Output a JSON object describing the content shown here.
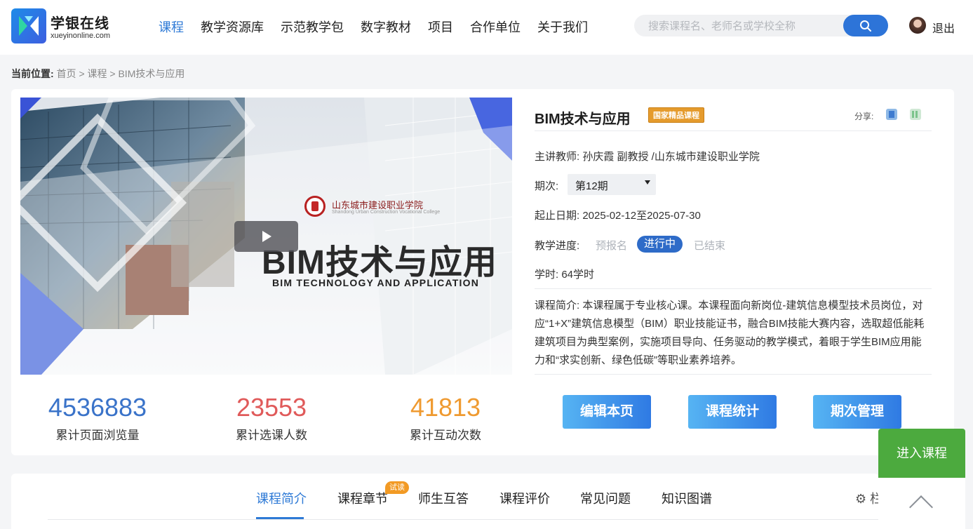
{
  "brand": {
    "name": "学银在线",
    "domain": "xueyinonline.com"
  },
  "nav": [
    "课程",
    "教学资源库",
    "示范教学包",
    "数字教材",
    "项目",
    "合作单位",
    "关于我们"
  ],
  "search": {
    "placeholder": "搜索课程名、老师名或学校全称"
  },
  "user": {
    "logout": "退出"
  },
  "breadcrumb": {
    "lead": "当前位置:",
    "path": "首页 > 课程 > BIM技术与应用"
  },
  "cover": {
    "school_cn": "山东城市建设职业学院",
    "school_en": "Shandong Urban Construction Vocational College",
    "title": "BIM技术与应用",
    "subtitle": "BIM TECHNOLOGY AND APPLICATION"
  },
  "course": {
    "title": "BIM技术与应用",
    "badge": "国家精品课程",
    "share_label": "分享:",
    "teacher": "主讲教师: 孙庆霞 副教授 /山东城市建设职业学院",
    "period_label": "期次:",
    "period_value": "第12期",
    "dates": "起止日期: 2025-02-12至2025-07-30",
    "progress_label": "教学进度:",
    "progress_steps": [
      "预报名",
      "进行中",
      "已结束"
    ],
    "hours": "学时: 64学时",
    "summary": "课程简介: 本课程属于专业核心课。本课程面向新岗位-建筑信息模型技术员岗位，对应“1+X”建筑信息模型（BIM）职业技能证书，融合BIM技能大赛内容，选取超低能耗建筑项目为典型案例，实施项目导向、任务驱动的教学模式，着眼于学生BIM应用能力和“求实创新、绿色低碳”等职业素养培养。"
  },
  "stats": [
    {
      "value": "4536883",
      "label": "累计页面浏览量",
      "color": "#3a73c9"
    },
    {
      "value": "23553",
      "label": "累计选课人数",
      "color": "#e05a5a"
    },
    {
      "value": "41813",
      "label": "累计互动次数",
      "color": "#ef9a30"
    }
  ],
  "actions": [
    "编辑本页",
    "课程统计",
    "期次管理"
  ],
  "enter_course": "进入课程",
  "tabs": [
    "课程简介",
    "课程章节",
    "师生互答",
    "课程评价",
    "常见问题",
    "知识图谱"
  ],
  "trial_badge": "试读",
  "tab_settings": "⚙ 栏"
}
